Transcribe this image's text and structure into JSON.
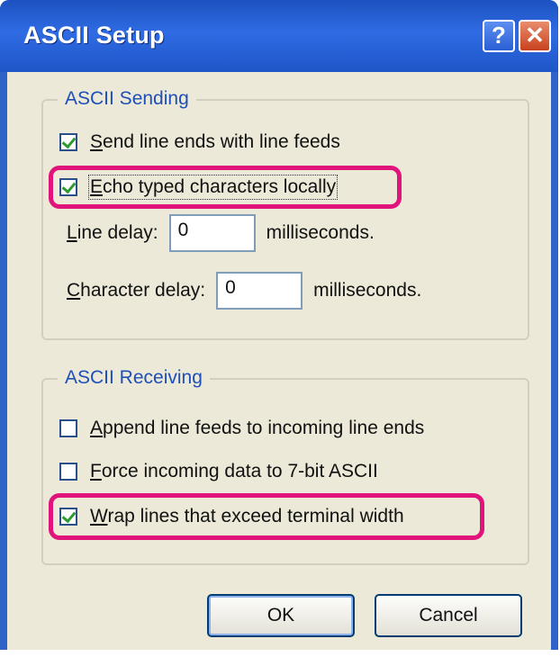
{
  "window": {
    "title": "ASCII Setup",
    "help_glyph": "?",
    "close_glyph": "✕"
  },
  "sending": {
    "legend": "ASCII Sending",
    "send_line_ends": {
      "mnemonic": "S",
      "rest": "end line ends with line feeds",
      "checked": true
    },
    "echo_typed": {
      "mnemonic": "E",
      "rest": "cho typed characters locally",
      "checked": true,
      "highlighted": true
    },
    "line_delay": {
      "mnemonic": "L",
      "rest": "ine delay:",
      "value": "0",
      "unit": "milliseconds."
    },
    "char_delay": {
      "mnemonic": "C",
      "rest": "haracter delay:",
      "value": "0",
      "unit": "milliseconds."
    }
  },
  "receiving": {
    "legend": "ASCII Receiving",
    "append_feeds": {
      "mnemonic": "A",
      "rest": "ppend line feeds to incoming line ends",
      "checked": false
    },
    "force_7bit": {
      "mnemonic": "F",
      "rest": "orce incoming data to 7-bit ASCII",
      "checked": false
    },
    "wrap_lines": {
      "mnemonic": "W",
      "rest": "rap lines that exceed terminal width",
      "checked": true,
      "highlighted": true
    }
  },
  "buttons": {
    "ok": "OK",
    "cancel": "Cancel"
  },
  "colors": {
    "title_bar": "#2f6be3",
    "highlight": "#e0147b",
    "dialog_face": "#ece9d8",
    "group_title": "#1e4fb8"
  }
}
